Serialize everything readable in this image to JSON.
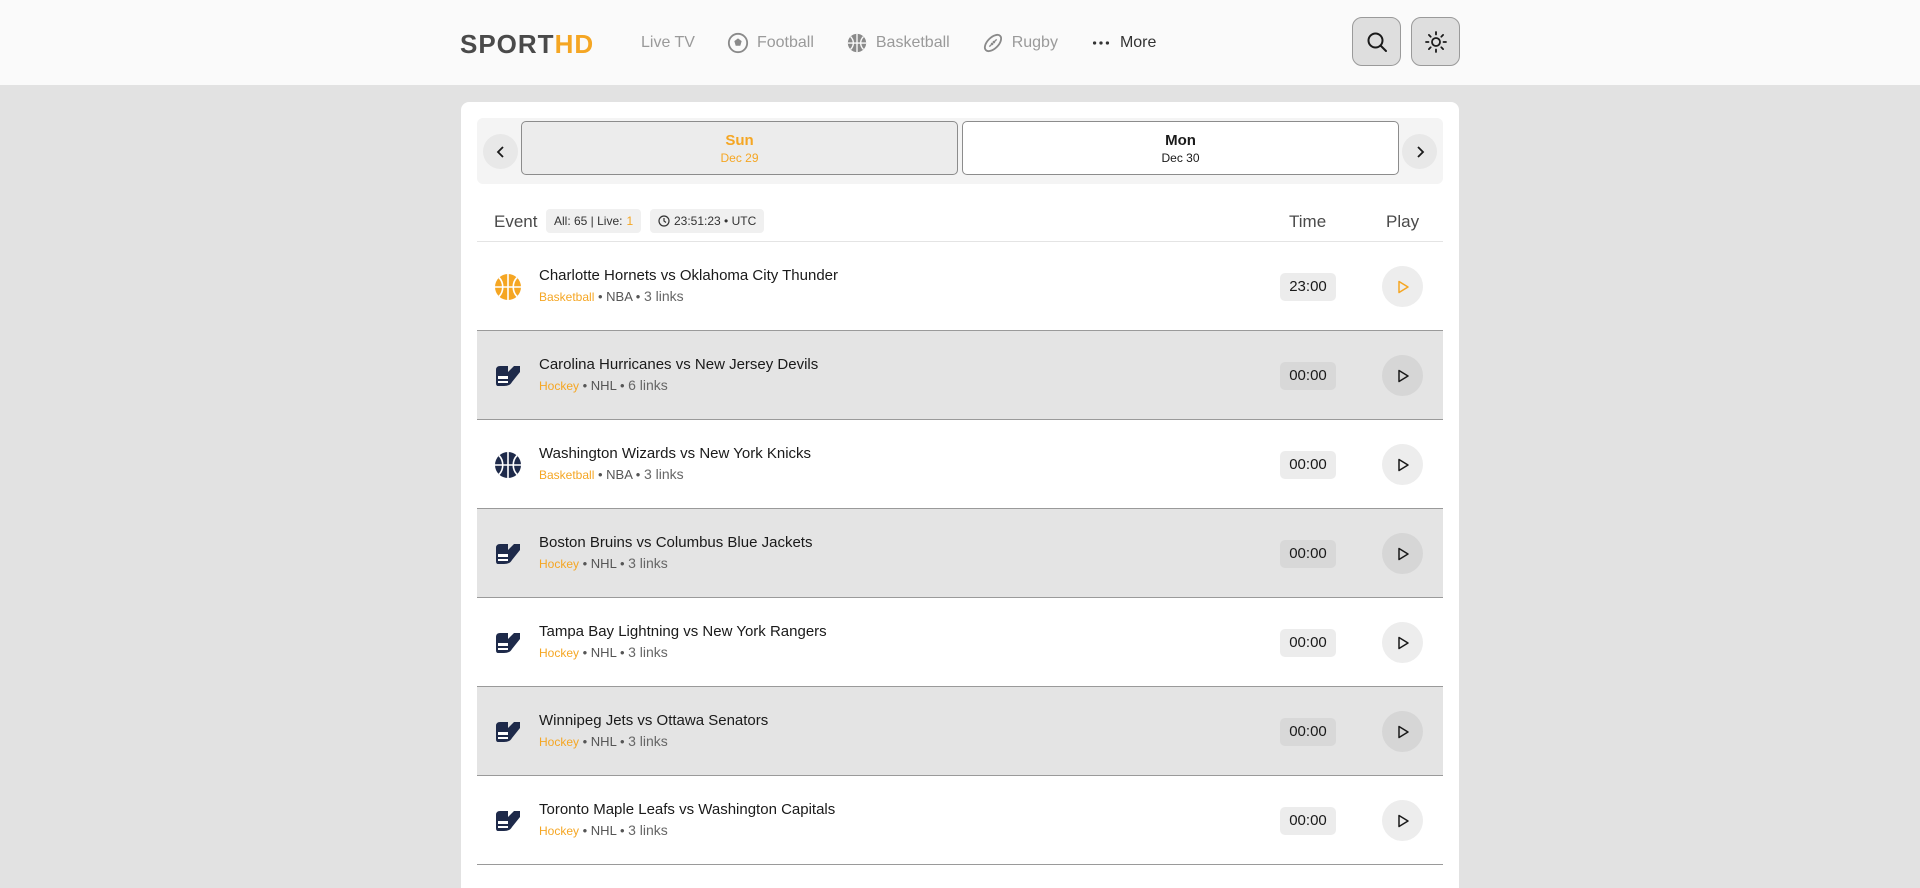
{
  "header": {
    "logo": {
      "part1": "SPORT",
      "part2": "HD"
    },
    "nav": [
      {
        "label": "Live TV",
        "icon": "none"
      },
      {
        "label": "Football",
        "icon": "football-icon"
      },
      {
        "label": "Basketball",
        "icon": "basketball-icon"
      },
      {
        "label": "Rugby",
        "icon": "rugby-icon"
      },
      {
        "label": "More",
        "icon": "more-icon"
      }
    ],
    "search_icon": "search-icon",
    "theme_icon": "sun-icon"
  },
  "dates": [
    {
      "day": "Sun",
      "date": "Dec 29",
      "active": true
    },
    {
      "day": "Mon",
      "date": "Dec 30",
      "active": false
    }
  ],
  "table": {
    "event_label": "Event",
    "counts_prefix": "All: 65 | Live: ",
    "live_count": "1",
    "clock": "23:51:23 • UTC",
    "time_label": "Time",
    "play_label": "Play"
  },
  "events": [
    {
      "title": "Charlotte Hornets vs Oklahoma City Thunder",
      "sport": "Basketball",
      "league": "NBA",
      "links": "3 links",
      "time": "23:00",
      "live": true
    },
    {
      "title": "Carolina Hurricanes vs New Jersey Devils",
      "sport": "Hockey",
      "league": "NHL",
      "links": "6 links",
      "time": "00:00",
      "live": false
    },
    {
      "title": "Washington Wizards vs New York Knicks",
      "sport": "Basketball",
      "league": "NBA",
      "links": "3 links",
      "time": "00:00",
      "live": false
    },
    {
      "title": "Boston Bruins vs Columbus Blue Jackets",
      "sport": "Hockey",
      "league": "NHL",
      "links": "3 links",
      "time": "00:00",
      "live": false
    },
    {
      "title": "Tampa Bay Lightning vs New York Rangers",
      "sport": "Hockey",
      "league": "NHL",
      "links": "3 links",
      "time": "00:00",
      "live": false
    },
    {
      "title": "Winnipeg Jets vs Ottawa Senators",
      "sport": "Hockey",
      "league": "NHL",
      "links": "3 links",
      "time": "00:00",
      "live": false
    },
    {
      "title": "Toronto Maple Leafs vs Washington Capitals",
      "sport": "Hockey",
      "league": "NHL",
      "links": "3 links",
      "time": "00:00",
      "live": false
    }
  ],
  "colors": {
    "accent": "#f5a623",
    "icon_dark": "#1e2a4a"
  }
}
